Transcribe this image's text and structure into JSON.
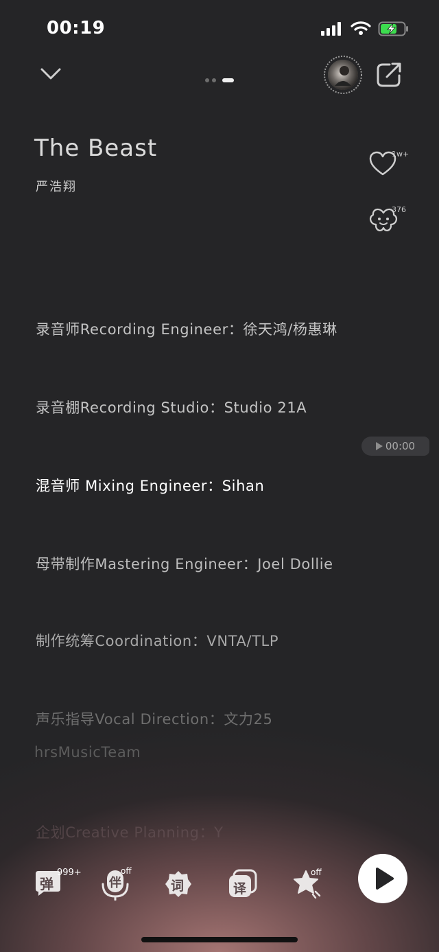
{
  "status": {
    "time": "00:19"
  },
  "header": {
    "page_indicator_count": 3
  },
  "song": {
    "title": "The Beast",
    "artist": "严浩翔"
  },
  "side": {
    "like_count": "1w+",
    "comment_count": "376"
  },
  "credits": [
    "录音师Recording Engineer：徐天鸿/杨惠琳",
    "录音棚Recording Studio：Studio 21A",
    "混音师 Mixing Engineer：Sihan",
    "母带制作Mastering Engineer：Joel Dollie",
    "制作统筹Coordination：VNTA/TLP",
    "声乐指导Vocal Direction：文力25",
    "hrsMusicTeam",
    "企划Creative Planning：Y"
  ],
  "playback": {
    "time_label": "00:00"
  },
  "toolbar": {
    "danmu_label": "弹",
    "danmu_count": "999+",
    "accompany_label": "伴",
    "accompany_state": "off",
    "lyrics_label": "词",
    "translate_label": "译",
    "effect_state": "off"
  },
  "colors": {
    "background": "#252527",
    "glow": "#a87876",
    "active_text": "#ffffff",
    "dim_text": "#bdbdbd"
  }
}
